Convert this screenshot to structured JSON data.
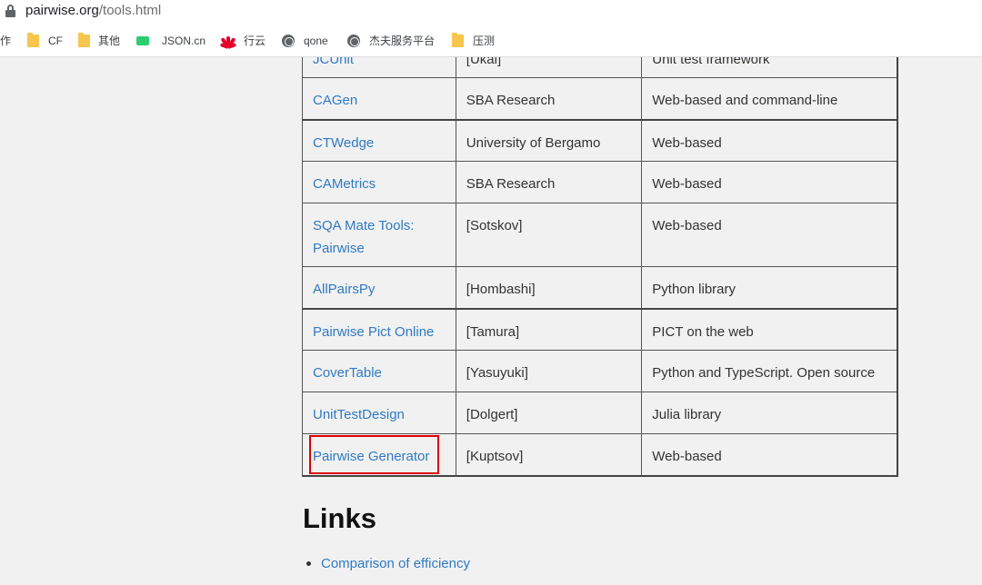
{
  "browser": {
    "url_host": "pairwise.org",
    "url_path": "/tools.html"
  },
  "bookmarks": [
    {
      "label": "作",
      "icon": "none"
    },
    {
      "label": "CF",
      "icon": "folder-icon"
    },
    {
      "label": "其他",
      "icon": "folder-icon"
    },
    {
      "label": "JSON.cn",
      "icon": "json-icon"
    },
    {
      "label": "行云",
      "icon": "huawei-icon"
    },
    {
      "label": "qone",
      "icon": "globe-icon"
    },
    {
      "label": "杰夫服务平台",
      "icon": "globe-icon"
    },
    {
      "label": "压测",
      "icon": "folder-icon"
    }
  ],
  "table": {
    "rows": [
      {
        "tool": "JCUnit",
        "author": "[Ukai]",
        "notes": "Unit test framework"
      },
      {
        "tool": "CAGen",
        "author": "SBA Research",
        "notes": "Web-based and command-line"
      },
      {
        "tool": "CTWedge",
        "author": "University of Bergamo",
        "notes": "Web-based"
      },
      {
        "tool": "CAMetrics",
        "author": "SBA Research",
        "notes": "Web-based"
      },
      {
        "tool": "SQA Mate Tools: Pairwise",
        "author": "[Sotskov]",
        "notes": "Web-based"
      },
      {
        "tool": "AllPairsPy",
        "author": "[Hombashi]",
        "notes": "Python library"
      },
      {
        "tool": "Pairwise Pict Online",
        "author": "[Tamura]",
        "notes": "PICT on the web"
      },
      {
        "tool": "CoverTable",
        "author": "[Yasuyuki]",
        "notes": "Python and TypeScript. Open source"
      },
      {
        "tool": "UnitTestDesign",
        "author": "[Dolgert]",
        "notes": "Julia library"
      },
      {
        "tool": "Pairwise Generator",
        "author": "[Kuptsov]",
        "notes": "Web-based"
      }
    ]
  },
  "links_section": {
    "heading": "Links",
    "items": [
      "Comparison of efficiency"
    ]
  },
  "colors": {
    "link": "#2f7ac4",
    "highlight": "#e00000",
    "page_bg": "#f1f1f1"
  }
}
